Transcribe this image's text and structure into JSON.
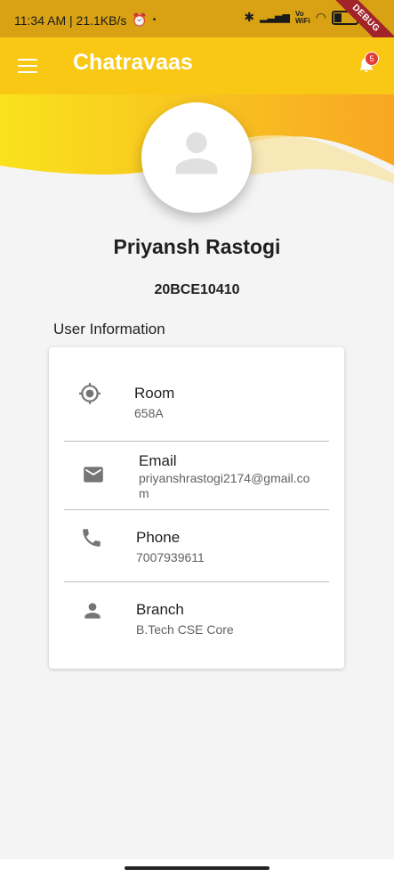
{
  "status_bar": {
    "time_info": "11:34 AM | 21.1KB/s",
    "debug_label": "DEBUG"
  },
  "app_bar": {
    "title": "Chatravaas",
    "notification_count": "5"
  },
  "profile": {
    "name": "Priyansh Rastogi",
    "reg_no": "20BCE10410"
  },
  "user_info": {
    "section_title": "User Information",
    "items": [
      {
        "icon": "location-target-icon",
        "label": "Room",
        "value": "658A"
      },
      {
        "icon": "email-icon",
        "label": "Email",
        "value": "priyanshrastogi2174@gmail.com"
      },
      {
        "icon": "phone-icon",
        "label": "Phone",
        "value": "7007939611"
      },
      {
        "icon": "person-icon",
        "label": "Branch",
        "value": "B.Tech CSE Core"
      }
    ]
  },
  "colors": {
    "accent": "#f9c814",
    "accent_dark": "#f7a823"
  }
}
